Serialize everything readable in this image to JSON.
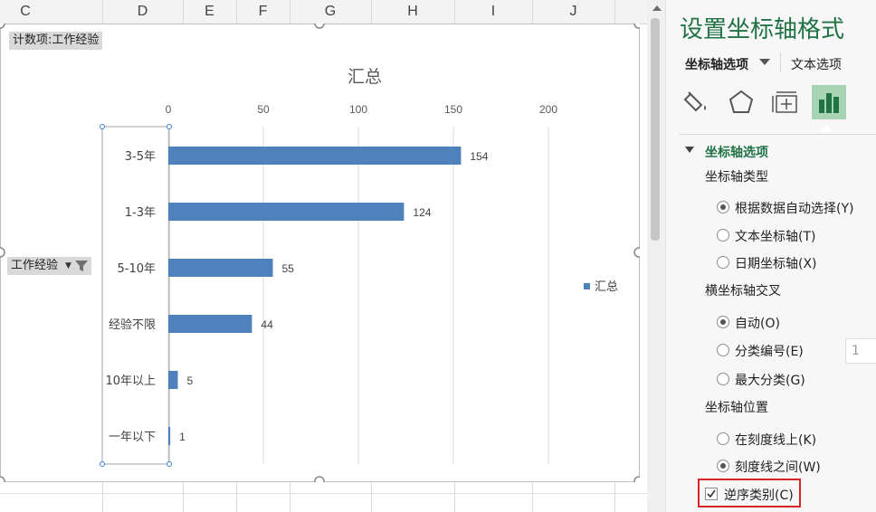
{
  "sheet": {
    "columns": [
      "C",
      "D",
      "E",
      "F",
      "G",
      "H",
      "I",
      "J"
    ]
  },
  "pivot": {
    "value_field": "计数项:工作经验",
    "row_field": "工作经验",
    "filter_icon": "filter-dropdown-icon"
  },
  "chart_data": {
    "type": "bar",
    "orientation": "horizontal",
    "title": "汇总",
    "categories": [
      "3-5年",
      "1-3年",
      "5-10年",
      "经验不限",
      "10年以上",
      "一年以下"
    ],
    "series": [
      {
        "name": "汇总",
        "values": [
          154,
          124,
          55,
          44,
          5,
          1
        ]
      }
    ],
    "xlim": [
      0,
      200
    ],
    "xticks": [
      0,
      50,
      100,
      150,
      200
    ],
    "axis_position": "top",
    "grid": true,
    "legend": "right",
    "bar_color": "#4f81bd",
    "reverse_categories": true
  },
  "panel": {
    "title": "设置坐标轴格式",
    "tab_axis": "坐标轴选项",
    "tab_text": "文本选项",
    "icons": [
      "fill-icon",
      "pentagon-effects-icon",
      "size-properties-icon",
      "bar-chart-options-icon"
    ],
    "section_title": "坐标轴选项",
    "axis_type": {
      "label": "坐标轴类型",
      "options": [
        "根据数据自动选择(Y)",
        "文本坐标轴(T)",
        "日期坐标轴(X)"
      ],
      "selected": 0
    },
    "cross": {
      "label": "横坐标轴交叉",
      "options": [
        "自动(O)",
        "分类编号(E)",
        "最大分类(G)"
      ],
      "selected": 0,
      "category_number": "1"
    },
    "position": {
      "label": "坐标轴位置",
      "options": [
        "在刻度线上(K)",
        "刻度线之间(W)"
      ],
      "selected": 1
    },
    "reverse_order": {
      "label": "逆序类别(C)",
      "checked": true
    }
  }
}
